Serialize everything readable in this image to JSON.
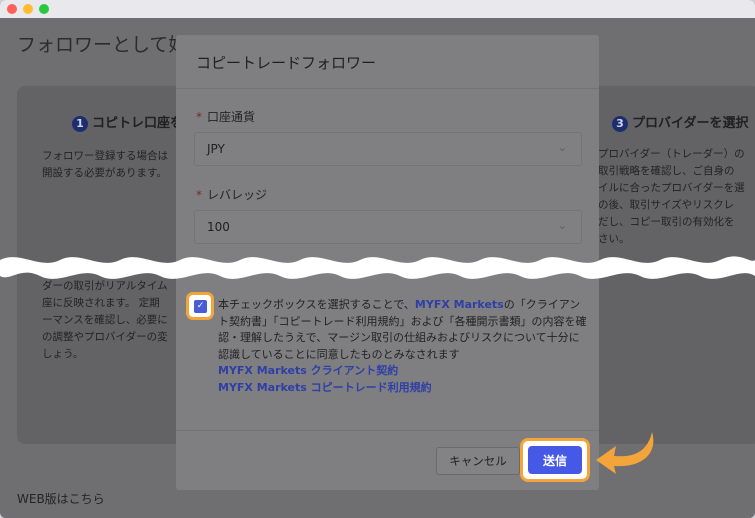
{
  "background": {
    "page_title": "フォロワーとして始める",
    "step1": {
      "num": "1",
      "label": "コピトレ口座を"
    },
    "step1_text": [
      "フォロワー登録する場合は",
      "開設する必要があります。"
    ],
    "step3": {
      "num": "3",
      "label": "プロバイダーを選択"
    },
    "step3_text": [
      "プロバイダー（トレーダー）の",
      "取引戦略を確認し、ご自身の",
      "イルに合ったプロバイダーを選",
      "の後、取引サイズやリスクレ",
      "だし、コピー取引の有効化を",
      "さい。"
    ],
    "step2_text": [
      "ダーの取引がリアルタイム",
      "座に反映されます。 定期",
      "ーマンスを確認し、必要に",
      "の調整やプロバイダーの変",
      "しょう。"
    ],
    "web_link": "WEB版はこちら"
  },
  "modal": {
    "title": "コピートレードフォロワー",
    "currency": {
      "required_mark": "*",
      "label": "口座通貨",
      "value": "JPY"
    },
    "leverage": {
      "required_mark": "*",
      "label": "レバレッジ",
      "value": "100"
    },
    "agreement": {
      "checked": true,
      "part1": "本チェックボックスを選択することで、",
      "brand": "MYFX Markets",
      "part2": "の「クライアント契約書」「コピートレード利用規約」および「各種開示書類」の内容を確認・理解したうえで、マージン取引の仕組みおよびリスクについて十分に認識していることに同意したものとみなされます"
    },
    "links": [
      "MYFX Markets クライアント契約",
      "MYFX Markets コピートレード利用規約"
    ],
    "cancel_label": "キャンセル",
    "submit_label": "送信"
  },
  "colors": {
    "highlight": "#f3a43b",
    "primary": "#4658e6"
  },
  "icons": {
    "chevron": "chevron-down-icon",
    "check": "check-icon",
    "arrow": "arrow-pointer-icon"
  }
}
